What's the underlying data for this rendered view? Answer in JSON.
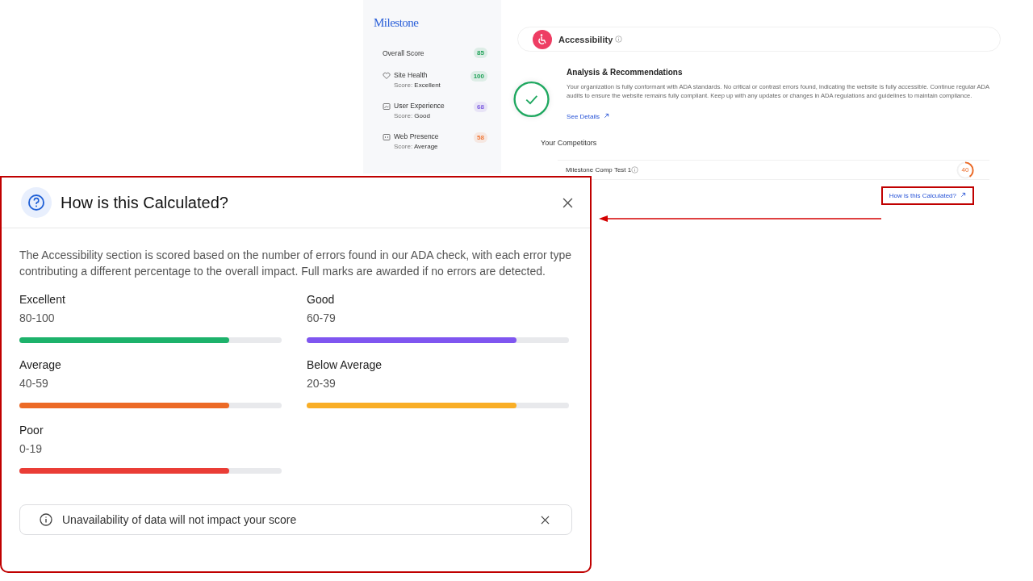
{
  "sidebar": {
    "logo": "Milestone",
    "overall": {
      "label": "Overall Score",
      "value": "85",
      "color": "#22a35a"
    },
    "items": [
      {
        "kind": "health",
        "title": "Site Health",
        "score_label": "Score:",
        "score": "Excellent",
        "value": "100",
        "color": "#22a35a"
      },
      {
        "kind": "experience",
        "title": "User Experience",
        "score_label": "Score:",
        "score": "Good",
        "value": "68",
        "color": "#7c5ce0"
      },
      {
        "kind": "presence",
        "title": "Web Presence",
        "score_label": "Score:",
        "score": "Average",
        "value": "58",
        "color": "#f07a3a"
      }
    ]
  },
  "section": {
    "title": "Accessibility",
    "analysis_title": "Analysis & Recommendations",
    "analysis_text": "Your organization is fully conformant with ADA standards. No critical or contrast errors found, indicating the website is fully accessible. Continue regular ADA audits to ensure the website remains fully compliant. Keep up with any updates or changes in ADA regulations and guidelines to maintain compliance.",
    "see_details": "See Details",
    "competitors_title": "Your Competitors",
    "competitors": [
      {
        "name": "Milestone Comp Test 1",
        "score": "40"
      }
    ],
    "calc_link": "How is this Calculated?"
  },
  "modal": {
    "title": "How is this Calculated?",
    "description": "The Accessibility section is scored based on the number of errors found in our ADA check, with each error type contributing a different percentage to the overall impact. Full marks are awarded if no errors are detected.",
    "bands": [
      {
        "label": "Excellent",
        "range": "80-100",
        "level": 0.8,
        "color": "#1db26b"
      },
      {
        "label": "Good",
        "range": "60-79",
        "level": 0.8,
        "color": "#7f56f0"
      },
      {
        "label": "Average",
        "range": "40-59",
        "level": 0.8,
        "color": "#ec6a26"
      },
      {
        "label": "Below Average",
        "range": "20-39",
        "level": 0.8,
        "color": "#f9ae26"
      },
      {
        "label": "Poor",
        "range": "0-19",
        "level": 0.8,
        "color": "#ea3d36"
      }
    ],
    "notice": "Unavailability of data will not impact your score"
  }
}
